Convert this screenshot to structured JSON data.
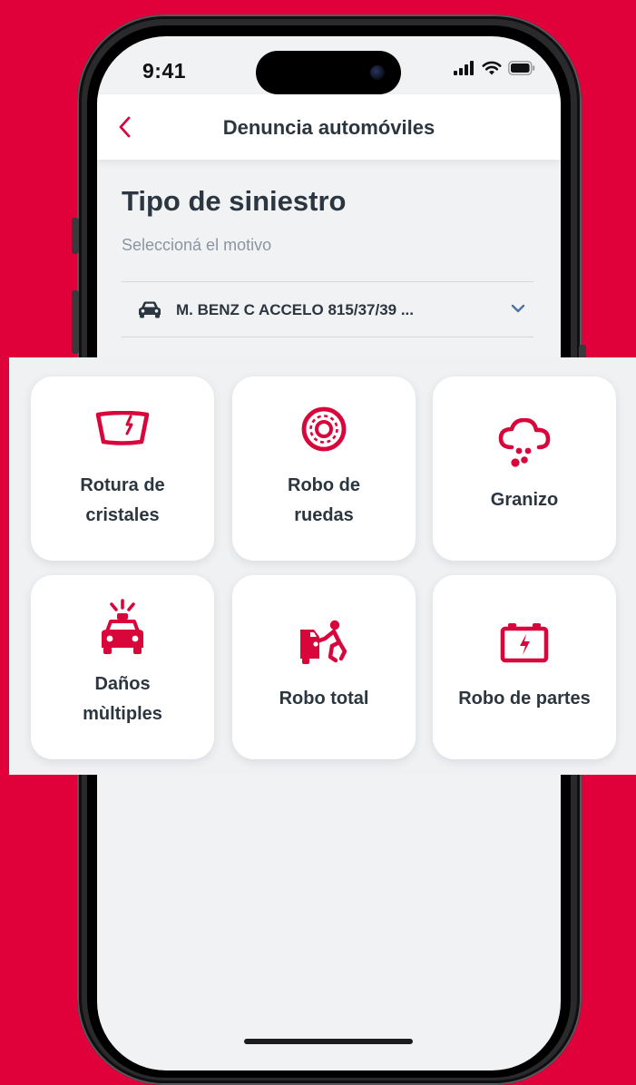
{
  "status_bar": {
    "time": "9:41"
  },
  "nav": {
    "title": "Denuncia automóviles",
    "back_icon": "chevron-left-icon"
  },
  "page": {
    "title": "Tipo de siniestro",
    "subtitle": "Seleccioná el motivo"
  },
  "vehicle": {
    "value": "M. BENZ C ACCELO 815/37/39 ...",
    "icon": "car-icon",
    "dropdown_icon": "chevron-down-icon"
  },
  "options": [
    {
      "line1": "Rotura de",
      "line2": "cristales",
      "icon": "windshield-crack-icon"
    },
    {
      "line1": "Robo de",
      "line2": "ruedas",
      "icon": "wheel-icon"
    },
    {
      "line1": "Granizo",
      "line2": "",
      "icon": "hail-cloud-icon"
    },
    {
      "line1": "Daños",
      "line2": "mùltiples",
      "icon": "car-alarm-icon"
    },
    {
      "line1": "Robo total",
      "line2": "",
      "icon": "car-theft-icon"
    },
    {
      "line1": "Robo de partes",
      "line2": "",
      "icon": "battery-icon"
    }
  ],
  "colors": {
    "brand": "#e0003a",
    "icon_red": "#d8063b",
    "text_dark": "#2b3640",
    "text_muted": "#8a95a3",
    "chevron_blue": "#4a72a8",
    "screen_bg": "#f1f2f4"
  }
}
